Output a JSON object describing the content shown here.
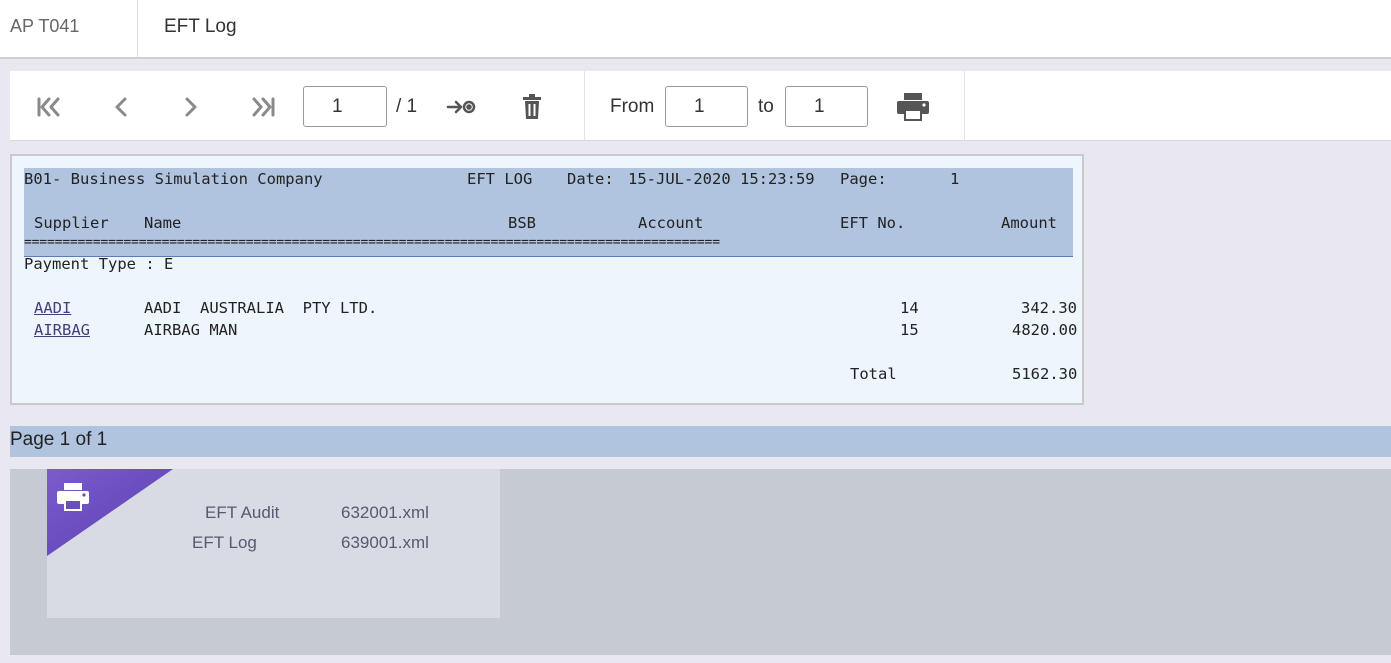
{
  "header": {
    "code": "AP T041",
    "title": "EFT Log"
  },
  "toolbar": {
    "page_current": "1",
    "page_total": "/ 1",
    "from_label": "From",
    "from_value": "1",
    "to_label": "to",
    "to_value": "1",
    "icons": [
      "first-page-icon",
      "prev-page-icon",
      "next-page-icon",
      "last-page-icon",
      "go-to-page-icon",
      "trash-icon",
      "print-icon"
    ]
  },
  "report": {
    "company": "B01- Business Simulation Company",
    "report_title": "EFT LOG",
    "date_label": "Date:",
    "date_value": "15-JUL-2020 15:23:59",
    "page_label": "Page:",
    "page_value": "1",
    "columns": [
      "Supplier",
      "Name",
      "BSB",
      "Account",
      "EFT No.",
      "Amount"
    ],
    "rule": "===========================================================================================",
    "payment_type": "Payment Type : E",
    "rows": [
      {
        "supplier": "AADI",
        "name": "AADI  AUSTRALIA  PTY LTD.",
        "bsb": "",
        "account": "",
        "eft_no": "14",
        "amount": "342.30"
      },
      {
        "supplier": "AIRBAG",
        "name": "AIRBAG MAN",
        "bsb": "",
        "account": "",
        "eft_no": "15",
        "amount": "4820.00"
      }
    ],
    "total_label": "Total",
    "total_value": "5162.30"
  },
  "pager": {
    "text": "Page 1 of 1"
  },
  "outputs": {
    "items": [
      {
        "name": "EFT Audit",
        "file": "632001.xml"
      },
      {
        "name": "EFT Log",
        "file": "639001.xml"
      }
    ],
    "accent": "#6a4ec0"
  }
}
